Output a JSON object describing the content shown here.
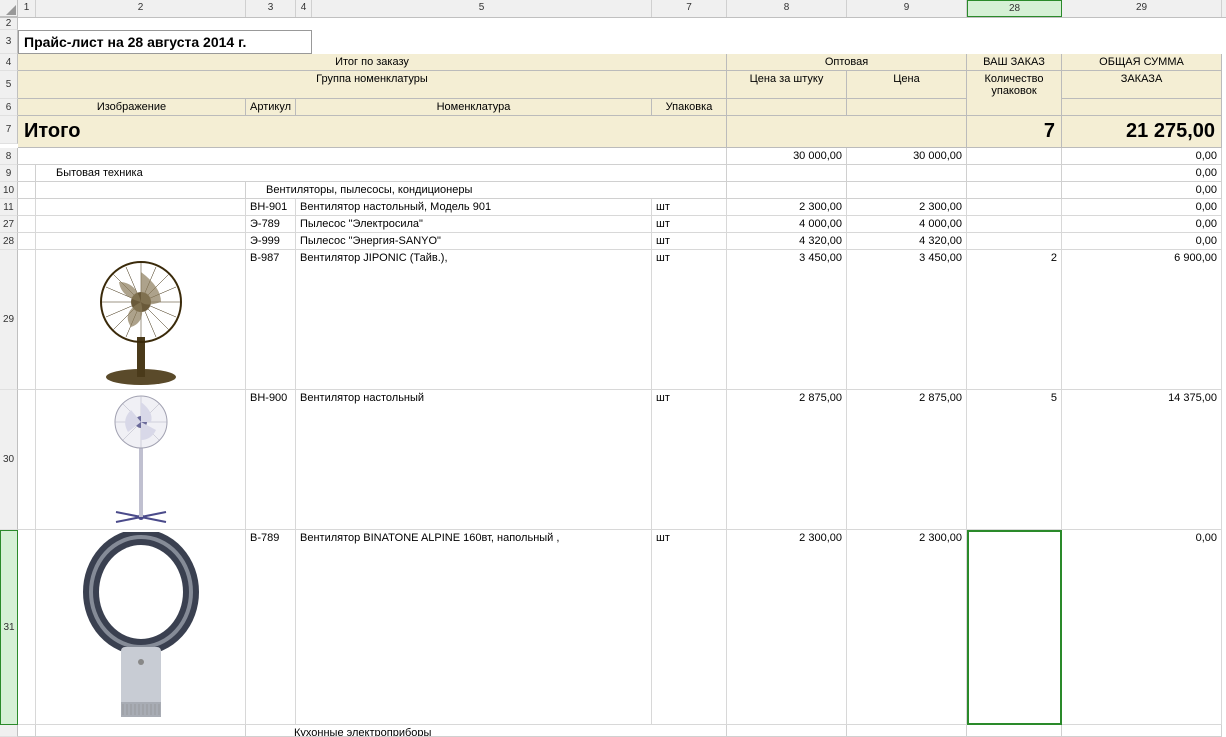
{
  "columns": [
    "1",
    "2",
    "3",
    "4",
    "5",
    "7",
    "8",
    "9",
    "28",
    "29"
  ],
  "rows": [
    "2",
    "3",
    "4",
    "5",
    "6",
    "7",
    "8",
    "9",
    "10",
    "11",
    "27",
    "28",
    "29",
    "30",
    "31"
  ],
  "selectedCol": "28",
  "selectedRow": "31",
  "title": "Прайс-лист на 28 августа 2014 г.",
  "headers": {
    "orderTotal": "Итог по заказу",
    "wholesale": "Оптовая",
    "yourOrder": "ВАШ ЗАКАЗ",
    "grandTotal": "ОБЩАЯ СУММА",
    "group": "Группа номенклатуры",
    "pricePerUnit": "Цена за штуку",
    "price": "Цена",
    "packCount": "Количество упаковок",
    "orderOf": "ЗАКАЗА",
    "image": "Изображение",
    "article": "Артикул",
    "nomenclature": "Номенклатура",
    "packaging": "Упаковка"
  },
  "totals": {
    "label": "Итого",
    "qty": "7",
    "sum": "21 275,00"
  },
  "overallRow": {
    "pricePerUnit": "30 000,00",
    "price": "30 000,00",
    "sum": "0,00"
  },
  "cat1": {
    "name": "Бытовая техника",
    "sum": "0,00"
  },
  "cat2": {
    "name": "Вентиляторы, пылесосы, кондиционеры",
    "sum": "0,00"
  },
  "items": [
    {
      "article": "ВН-901",
      "name": "Вентилятор настольный, Модель 901",
      "unit": "шт",
      "pricePerUnit": "2 300,00",
      "price": "2 300,00",
      "qty": "",
      "sum": "0,00",
      "img": ""
    },
    {
      "article": "Э-789",
      "name": "Пылесос \"Электросила\"",
      "unit": "шт",
      "pricePerUnit": "4 000,00",
      "price": "4 000,00",
      "qty": "",
      "sum": "0,00",
      "img": ""
    },
    {
      "article": "Э-999",
      "name": "Пылесос \"Энергия-SANYO\"",
      "unit": "шт",
      "pricePerUnit": "4 320,00",
      "price": "4 320,00",
      "qty": "",
      "sum": "0,00",
      "img": ""
    },
    {
      "article": "В-987",
      "name": "Вентилятор JIPONIC (Тайв.),",
      "unit": "шт",
      "pricePerUnit": "3 450,00",
      "price": "3 450,00",
      "qty": "2",
      "sum": "6 900,00",
      "img": "fan-desk-bronze"
    },
    {
      "article": "ВН-900",
      "name": "Вентилятор настольный",
      "unit": "шт",
      "pricePerUnit": "2 875,00",
      "price": "2 875,00",
      "qty": "5",
      "sum": "14 375,00",
      "img": "fan-stand-white"
    },
    {
      "article": "В-789",
      "name": "Вентилятор BINATONE ALPINE 160вт, напольный ,",
      "unit": "шт",
      "pricePerUnit": "2 300,00",
      "price": "2 300,00",
      "qty": "",
      "sum": "0,00",
      "img": "fan-bladeless"
    }
  ],
  "cat3": {
    "name": "Кухонные электроприборы"
  }
}
